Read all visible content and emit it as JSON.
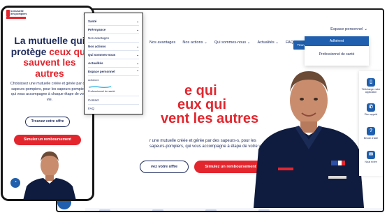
{
  "desktop": {
    "nav_links": [
      "Nos avantages",
      "Nos actions",
      "Qui sommes-nous",
      "Actualités",
      "FAQ"
    ],
    "nav_chevron": "⌄",
    "espace_label": "Espace personnel",
    "espace_chevron": "⌄",
    "small_button_label": "Trouver",
    "dropdown": {
      "active_label": "Adhérent",
      "item_label": "Professionnel de santé"
    },
    "hero": {
      "title_line1_hl": "e qui",
      "title_line2_hl": "eux qui",
      "title_line3_hl": "vent les autres",
      "text": "r une mutuelle créée et gérée par des sapeurs-s, pour les sapeurs-pompiers, qui vous accompagne à étape de votre vie.",
      "btn_outline": "vez votre offre",
      "btn_red": "Simulez un remboursement"
    },
    "side_panel": [
      {
        "icon": "phone-icon",
        "glyph": "▯",
        "label": "Télécharger notre application"
      },
      {
        "icon": "call-icon",
        "glyph": "✆",
        "label": "Être rappelé"
      },
      {
        "icon": "help-icon",
        "glyph": "?",
        "label": "Besoin d'aide"
      },
      {
        "icon": "mail-icon",
        "glyph": "✉",
        "label": "Nous écrire"
      }
    ],
    "scroll_glyph": "⌃"
  },
  "phone": {
    "logo_line1": "la mutuelle",
    "logo_line2": "des pompiers",
    "burger_glyph": "≡",
    "title_part1": "La mutuelle qui protège ",
    "title_hl": "ceux qui sauvent les autres",
    "text": "Choisissez une mutuelle créée et gérée par des sapeurs-pompiers, pour les sapeurs-pompiers, qui vous accompagne à chaque étape de votre vie.",
    "btn_outline": "Trouvez votre offre",
    "btn_red": "Simulez un remboursement",
    "chat_glyph": "◔"
  },
  "menu": {
    "items": [
      {
        "label": "Santé",
        "chev": "⌄",
        "bold": true
      },
      {
        "label": "Prévoyance",
        "chev": "⌄",
        "bold": true
      },
      {
        "label": "Nos avantages",
        "chev": "",
        "bold": false
      },
      {
        "label": "Nos actions",
        "chev": "⌄",
        "bold": true
      },
      {
        "label": "Qui sommes-nous",
        "chev": "⌄",
        "bold": true
      },
      {
        "label": "Actualités",
        "chev": "⌄",
        "bold": true
      },
      {
        "label": "Espace personnel",
        "chev": "⌃",
        "bold": true
      },
      {
        "label": "Adhérent",
        "chev": "",
        "bold": false
      },
      {
        "label": "Professionnel de santé",
        "chev": "",
        "bold": false
      },
      {
        "label": "Contact",
        "chev": "",
        "bold": false
      },
      {
        "label": "FAQ",
        "chev": "",
        "bold": false
      }
    ]
  },
  "colors": {
    "navy": "#1c2a5c",
    "red": "#e3262e",
    "blue": "#1f5fad",
    "uniform": "#0f1c3f"
  }
}
